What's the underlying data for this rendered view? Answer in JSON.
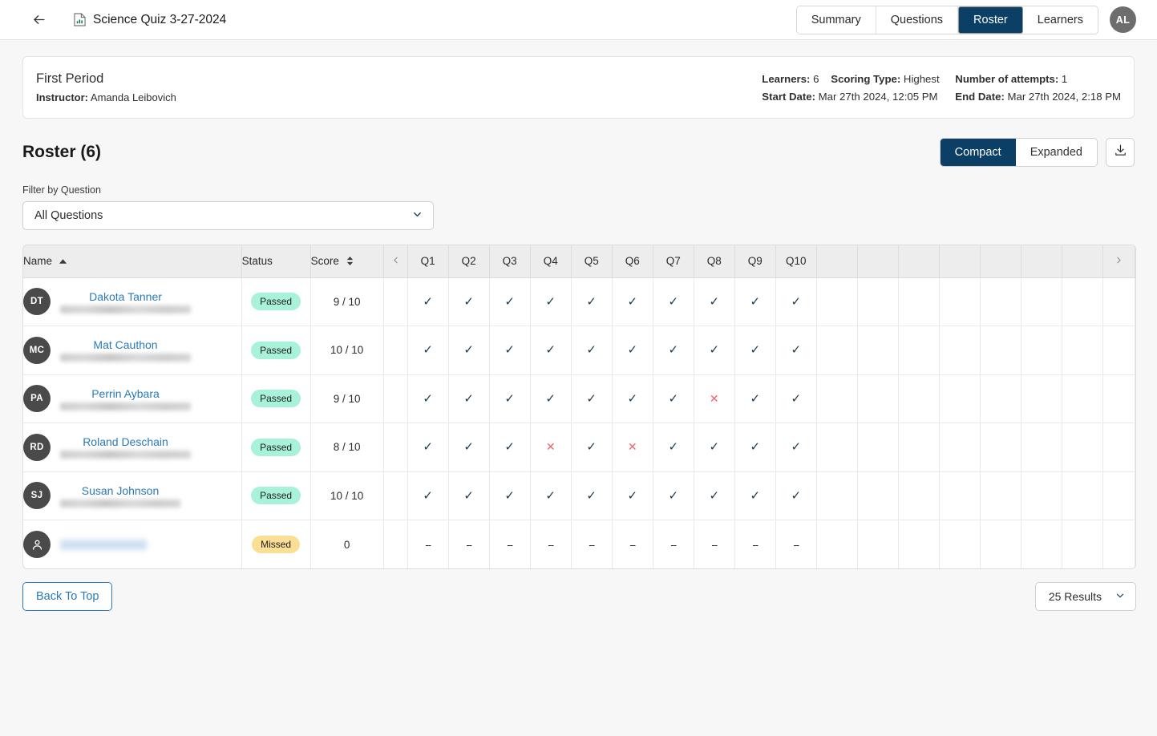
{
  "header": {
    "back_icon": "arrow-left-icon",
    "doc_icon": "quiz-document-icon",
    "title": "Science Quiz 3-27-2024",
    "tabs": [
      {
        "label": "Summary",
        "active": false
      },
      {
        "label": "Questions",
        "active": false
      },
      {
        "label": "Roster",
        "active": true
      },
      {
        "label": "Learners",
        "active": false
      }
    ],
    "avatar_initials": "AL"
  },
  "info_card": {
    "period": "First Period",
    "instructor_label": "Instructor:",
    "instructor_name": "Amanda Leibovich",
    "learners_label": "Learners:",
    "learners_value": "6",
    "scoring_label": "Scoring Type:",
    "scoring_value": "Highest",
    "attempts_label": "Number of attempts:",
    "attempts_value": "1",
    "start_label": "Start Date:",
    "start_value": "Mar 27th 2024, 12:05 PM",
    "end_label": "End Date:",
    "end_value": "Mar 27th 2024, 2:18 PM"
  },
  "roster": {
    "title": "Roster (6)",
    "view_compact": "Compact",
    "view_expanded": "Expanded",
    "active_view": "Compact",
    "download_icon": "download-icon",
    "filter_label": "Filter by Question",
    "filter_value": "All Questions",
    "filter_chevron": "chevron-down-icon"
  },
  "table": {
    "columns": {
      "name": "Name",
      "status": "Status",
      "score": "Score",
      "prev_icon": "chevron-left-icon",
      "next_icon": "chevron-right-icon",
      "questions": [
        "Q1",
        "Q2",
        "Q3",
        "Q4",
        "Q5",
        "Q6",
        "Q7",
        "Q8",
        "Q9",
        "Q10"
      ],
      "empty_columns": 7
    },
    "sort": {
      "name_sort_icon": "caret-up-icon",
      "score_sort_icon": "caret-up-down-icon"
    },
    "rows": [
      {
        "initials": "DT",
        "name": "Dakota Tanner",
        "redacted": false,
        "email_redacted": true,
        "status": "Passed",
        "status_type": "passed",
        "score": "9 / 10",
        "answers": [
          "check",
          "check",
          "check",
          "check",
          "check",
          "check",
          "check",
          "check",
          "check",
          "check"
        ]
      },
      {
        "initials": "MC",
        "name": "Mat Cauthon",
        "redacted": false,
        "email_redacted": true,
        "status": "Passed",
        "status_type": "passed",
        "score": "10 / 10",
        "answers": [
          "check",
          "check",
          "check",
          "check",
          "check",
          "check",
          "check",
          "check",
          "check",
          "check"
        ]
      },
      {
        "initials": "PA",
        "name": "Perrin Aybara",
        "redacted": false,
        "email_redacted": true,
        "status": "Passed",
        "status_type": "passed",
        "score": "9 / 10",
        "answers": [
          "check",
          "check",
          "check",
          "check",
          "check",
          "check",
          "check",
          "cross",
          "check",
          "check"
        ]
      },
      {
        "initials": "RD",
        "name": "Roland Deschain",
        "redacted": false,
        "email_redacted": true,
        "status": "Passed",
        "status_type": "passed",
        "score": "8 / 10",
        "answers": [
          "check",
          "check",
          "check",
          "cross",
          "check",
          "cross",
          "check",
          "check",
          "check",
          "check"
        ]
      },
      {
        "initials": "SJ",
        "name": "Susan Johnson",
        "redacted": false,
        "email_redacted": true,
        "status": "Passed",
        "status_type": "passed",
        "score": "10 / 10",
        "answers": [
          "check",
          "check",
          "check",
          "check",
          "check",
          "check",
          "check",
          "check",
          "check",
          "check"
        ]
      },
      {
        "initials": "person-icon",
        "name": "",
        "redacted": true,
        "email_redacted": false,
        "status": "Missed",
        "status_type": "missed",
        "score": "0",
        "answers": [
          "dash",
          "dash",
          "dash",
          "dash",
          "dash",
          "dash",
          "dash",
          "dash",
          "dash",
          "dash"
        ]
      }
    ],
    "marks": {
      "check": "✓",
      "cross": "✕",
      "dash": "--"
    }
  },
  "footer": {
    "back_to_top": "Back To Top",
    "results": "25 Results",
    "results_chevron": "chevron-down-icon"
  },
  "colors": {
    "accent_navy": "#0b3f66",
    "link_blue": "#2a7ab9",
    "passed_green": "#a8f2da",
    "missed_yellow": "#fbdf95",
    "cross_red": "#f4636a",
    "check_dark": "#1f3a4d"
  }
}
